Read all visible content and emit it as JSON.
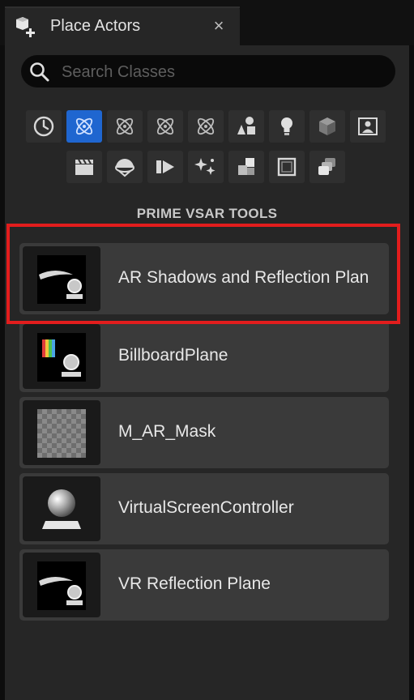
{
  "tab": {
    "title": "Place Actors",
    "close_glyph": "×",
    "icon": "place-actors-icon"
  },
  "search": {
    "placeholder": "Search Classes",
    "value": ""
  },
  "filters": {
    "row1": [
      "recently-placed-icon",
      "atom-icon",
      "atom-icon",
      "atom-icon",
      "atom-icon",
      "shapes-icon",
      "lightbulb-icon",
      "cube-icon",
      "portrait-icon"
    ],
    "row2": [
      "clapperboard-icon",
      "hemisphere-icon",
      "film-frames-icon",
      "sparkles-icon",
      "blocks-icon",
      "frame-icon",
      "stacked-planes-icon"
    ],
    "active_index": 1
  },
  "section": {
    "title": "PRIME VSAR TOOLS"
  },
  "items": [
    {
      "label": "AR Shadows and Reflection Plan",
      "thumb": "reflection-plane-thumb"
    },
    {
      "label": "BillboardPlane",
      "thumb": "billboard-thumb"
    },
    {
      "label": "M_AR_Mask",
      "thumb": "checker-material-thumb"
    },
    {
      "label": "VirtualScreenController",
      "thumb": "sphere-pedestal-thumb"
    },
    {
      "label": "VR Reflection Plane",
      "thumb": "reflection-plane-thumb"
    }
  ],
  "colors": {
    "accent_blue": "#1f66d0",
    "highlight_red": "#e21d1d",
    "panel_bg": "#262626",
    "row_bg": "#3a3a3a"
  }
}
